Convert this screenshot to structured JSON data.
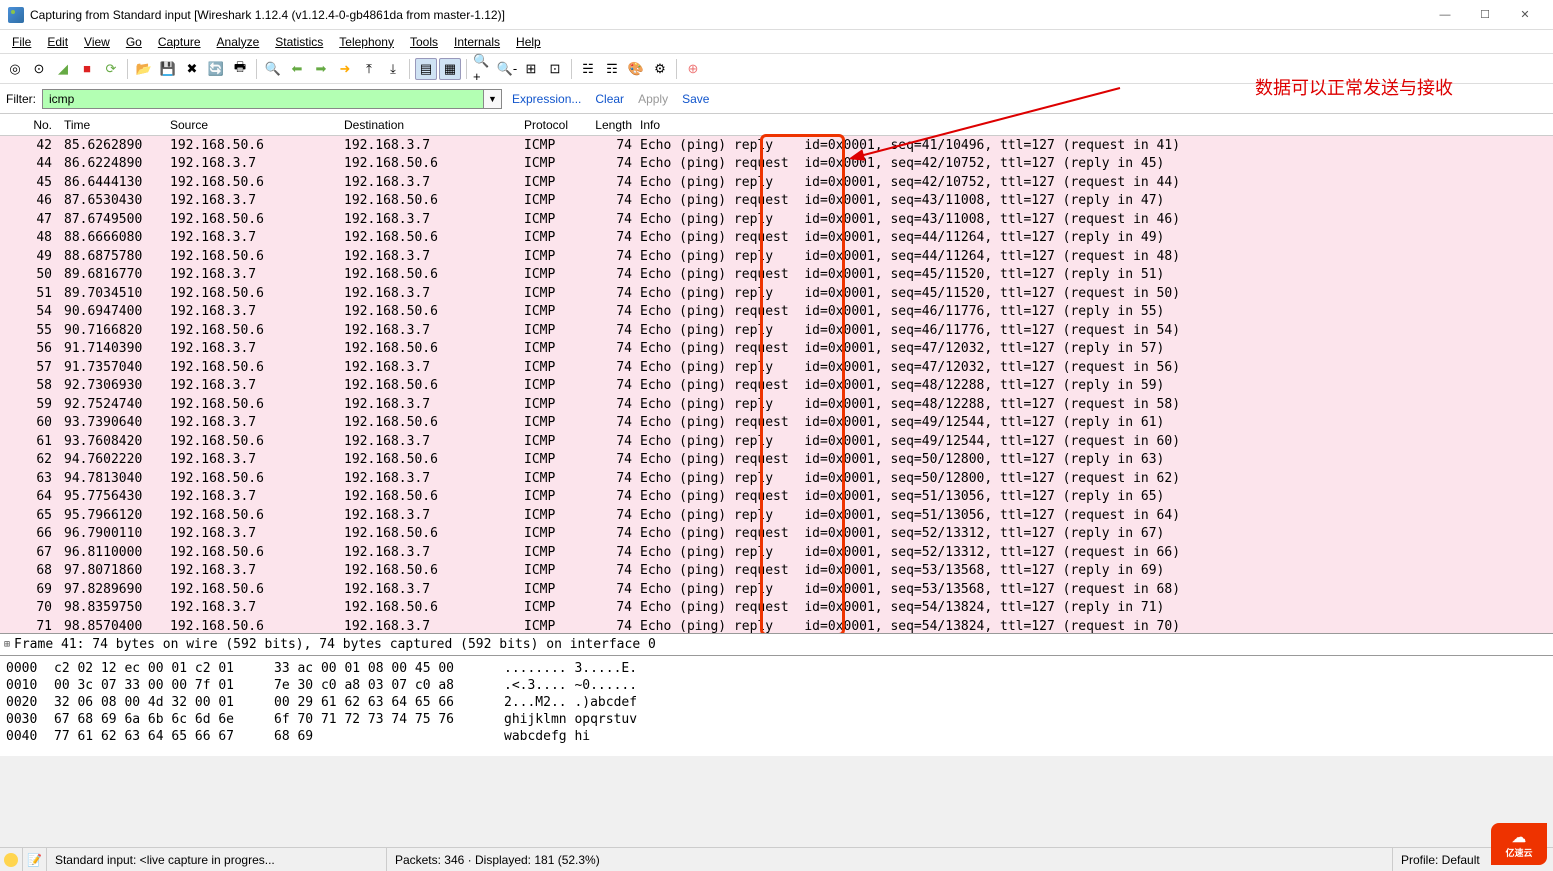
{
  "window": {
    "title": "Capturing from Standard input   [Wireshark 1.12.4  (v1.12.4-0-gb4861da from master-1.12)]",
    "min": "—",
    "max": "☐",
    "close": "✕"
  },
  "menu": {
    "file": "File",
    "edit": "Edit",
    "view": "View",
    "go": "Go",
    "capture": "Capture",
    "analyze": "Analyze",
    "statistics": "Statistics",
    "telephony": "Telephony",
    "tools": "Tools",
    "internals": "Internals",
    "help": "Help"
  },
  "filter": {
    "label": "Filter:",
    "value": "icmp",
    "expression": "Expression...",
    "clear": "Clear",
    "apply": "Apply",
    "save": "Save"
  },
  "annotation": "数据可以正常发送与接收",
  "columns": {
    "no": "No.",
    "time": "Time",
    "src": "Source",
    "dst": "Destination",
    "proto": "Protocol",
    "len": "Length",
    "info": "Info"
  },
  "packets": [
    {
      "no": 42,
      "time": "85.6262890",
      "src": "192.168.50.6",
      "dst": "192.168.3.7",
      "proto": "ICMP",
      "len": 74,
      "info": "Echo (ping) reply    id=0x0001, seq=41/10496, ttl=127 (request in 41)"
    },
    {
      "no": 44,
      "time": "86.6224890",
      "src": "192.168.3.7",
      "dst": "192.168.50.6",
      "proto": "ICMP",
      "len": 74,
      "info": "Echo (ping) request  id=0x0001, seq=42/10752, ttl=127 (reply in 45)"
    },
    {
      "no": 45,
      "time": "86.6444130",
      "src": "192.168.50.6",
      "dst": "192.168.3.7",
      "proto": "ICMP",
      "len": 74,
      "info": "Echo (ping) reply    id=0x0001, seq=42/10752, ttl=127 (request in 44)"
    },
    {
      "no": 46,
      "time": "87.6530430",
      "src": "192.168.3.7",
      "dst": "192.168.50.6",
      "proto": "ICMP",
      "len": 74,
      "info": "Echo (ping) request  id=0x0001, seq=43/11008, ttl=127 (reply in 47)"
    },
    {
      "no": 47,
      "time": "87.6749500",
      "src": "192.168.50.6",
      "dst": "192.168.3.7",
      "proto": "ICMP",
      "len": 74,
      "info": "Echo (ping) reply    id=0x0001, seq=43/11008, ttl=127 (request in 46)"
    },
    {
      "no": 48,
      "time": "88.6666080",
      "src": "192.168.3.7",
      "dst": "192.168.50.6",
      "proto": "ICMP",
      "len": 74,
      "info": "Echo (ping) request  id=0x0001, seq=44/11264, ttl=127 (reply in 49)"
    },
    {
      "no": 49,
      "time": "88.6875780",
      "src": "192.168.50.6",
      "dst": "192.168.3.7",
      "proto": "ICMP",
      "len": 74,
      "info": "Echo (ping) reply    id=0x0001, seq=44/11264, ttl=127 (request in 48)"
    },
    {
      "no": 50,
      "time": "89.6816770",
      "src": "192.168.3.7",
      "dst": "192.168.50.6",
      "proto": "ICMP",
      "len": 74,
      "info": "Echo (ping) request  id=0x0001, seq=45/11520, ttl=127 (reply in 51)"
    },
    {
      "no": 51,
      "time": "89.7034510",
      "src": "192.168.50.6",
      "dst": "192.168.3.7",
      "proto": "ICMP",
      "len": 74,
      "info": "Echo (ping) reply    id=0x0001, seq=45/11520, ttl=127 (request in 50)"
    },
    {
      "no": 54,
      "time": "90.6947400",
      "src": "192.168.3.7",
      "dst": "192.168.50.6",
      "proto": "ICMP",
      "len": 74,
      "info": "Echo (ping) request  id=0x0001, seq=46/11776, ttl=127 (reply in 55)"
    },
    {
      "no": 55,
      "time": "90.7166820",
      "src": "192.168.50.6",
      "dst": "192.168.3.7",
      "proto": "ICMP",
      "len": 74,
      "info": "Echo (ping) reply    id=0x0001, seq=46/11776, ttl=127 (request in 54)"
    },
    {
      "no": 56,
      "time": "91.7140390",
      "src": "192.168.3.7",
      "dst": "192.168.50.6",
      "proto": "ICMP",
      "len": 74,
      "info": "Echo (ping) request  id=0x0001, seq=47/12032, ttl=127 (reply in 57)"
    },
    {
      "no": 57,
      "time": "91.7357040",
      "src": "192.168.50.6",
      "dst": "192.168.3.7",
      "proto": "ICMP",
      "len": 74,
      "info": "Echo (ping) reply    id=0x0001, seq=47/12032, ttl=127 (request in 56)"
    },
    {
      "no": 58,
      "time": "92.7306930",
      "src": "192.168.3.7",
      "dst": "192.168.50.6",
      "proto": "ICMP",
      "len": 74,
      "info": "Echo (ping) request  id=0x0001, seq=48/12288, ttl=127 (reply in 59)"
    },
    {
      "no": 59,
      "time": "92.7524740",
      "src": "192.168.50.6",
      "dst": "192.168.3.7",
      "proto": "ICMP",
      "len": 74,
      "info": "Echo (ping) reply    id=0x0001, seq=48/12288, ttl=127 (request in 58)"
    },
    {
      "no": 60,
      "time": "93.7390640",
      "src": "192.168.3.7",
      "dst": "192.168.50.6",
      "proto": "ICMP",
      "len": 74,
      "info": "Echo (ping) request  id=0x0001, seq=49/12544, ttl=127 (reply in 61)"
    },
    {
      "no": 61,
      "time": "93.7608420",
      "src": "192.168.50.6",
      "dst": "192.168.3.7",
      "proto": "ICMP",
      "len": 74,
      "info": "Echo (ping) reply    id=0x0001, seq=49/12544, ttl=127 (request in 60)"
    },
    {
      "no": 62,
      "time": "94.7602220",
      "src": "192.168.3.7",
      "dst": "192.168.50.6",
      "proto": "ICMP",
      "len": 74,
      "info": "Echo (ping) request  id=0x0001, seq=50/12800, ttl=127 (reply in 63)"
    },
    {
      "no": 63,
      "time": "94.7813040",
      "src": "192.168.50.6",
      "dst": "192.168.3.7",
      "proto": "ICMP",
      "len": 74,
      "info": "Echo (ping) reply    id=0x0001, seq=50/12800, ttl=127 (request in 62)"
    },
    {
      "no": 64,
      "time": "95.7756430",
      "src": "192.168.3.7",
      "dst": "192.168.50.6",
      "proto": "ICMP",
      "len": 74,
      "info": "Echo (ping) request  id=0x0001, seq=51/13056, ttl=127 (reply in 65)"
    },
    {
      "no": 65,
      "time": "95.7966120",
      "src": "192.168.50.6",
      "dst": "192.168.3.7",
      "proto": "ICMP",
      "len": 74,
      "info": "Echo (ping) reply    id=0x0001, seq=51/13056, ttl=127 (request in 64)"
    },
    {
      "no": 66,
      "time": "96.7900110",
      "src": "192.168.3.7",
      "dst": "192.168.50.6",
      "proto": "ICMP",
      "len": 74,
      "info": "Echo (ping) request  id=0x0001, seq=52/13312, ttl=127 (reply in 67)"
    },
    {
      "no": 67,
      "time": "96.8110000",
      "src": "192.168.50.6",
      "dst": "192.168.3.7",
      "proto": "ICMP",
      "len": 74,
      "info": "Echo (ping) reply    id=0x0001, seq=52/13312, ttl=127 (request in 66)"
    },
    {
      "no": 68,
      "time": "97.8071860",
      "src": "192.168.3.7",
      "dst": "192.168.50.6",
      "proto": "ICMP",
      "len": 74,
      "info": "Echo (ping) request  id=0x0001, seq=53/13568, ttl=127 (reply in 69)"
    },
    {
      "no": 69,
      "time": "97.8289690",
      "src": "192.168.50.6",
      "dst": "192.168.3.7",
      "proto": "ICMP",
      "len": 74,
      "info": "Echo (ping) reply    id=0x0001, seq=53/13568, ttl=127 (request in 68)"
    },
    {
      "no": 70,
      "time": "98.8359750",
      "src": "192.168.3.7",
      "dst": "192.168.50.6",
      "proto": "ICMP",
      "len": 74,
      "info": "Echo (ping) request  id=0x0001, seq=54/13824, ttl=127 (reply in 71)"
    },
    {
      "no": 71,
      "time": "98.8570400",
      "src": "192.168.50.6",
      "dst": "192.168.3.7",
      "proto": "ICMP",
      "len": 74,
      "info": "Echo (ping) reply    id=0x0001, seq=54/13824, ttl=127 (request in 70)"
    }
  ],
  "detail": {
    "frame": "Frame 41: 74 bytes on wire (592 bits), 74 bytes captured (592 bits) on interface 0"
  },
  "hex": [
    {
      "off": "0000",
      "b1": "c2 02 12 ec 00 01 c2 01",
      "b2": "33 ac 00 01 08 00 45 00",
      "a": "........ 3.....E."
    },
    {
      "off": "0010",
      "b1": "00 3c 07 33 00 00 7f 01",
      "b2": "7e 30 c0 a8 03 07 c0 a8",
      "a": ".<.3.... ~0......"
    },
    {
      "off": "0020",
      "b1": "32 06 08 00 4d 32 00 01",
      "b2": "00 29 61 62 63 64 65 66",
      "a": "2...M2.. .)abcdef"
    },
    {
      "off": "0030",
      "b1": "67 68 69 6a 6b 6c 6d 6e",
      "b2": "6f 70 71 72 73 74 75 76",
      "a": "ghijklmn opqrstuv"
    },
    {
      "off": "0040",
      "b1": "77 61 62 63 64 65 66 67",
      "b2": "68 69",
      "a": "wabcdefg hi"
    }
  ],
  "status": {
    "source": "Standard input: <live capture in progres...",
    "packets": "Packets: 346 · Displayed: 181 (52.3%)",
    "profile": "Profile: Default"
  },
  "badge": "亿速云"
}
